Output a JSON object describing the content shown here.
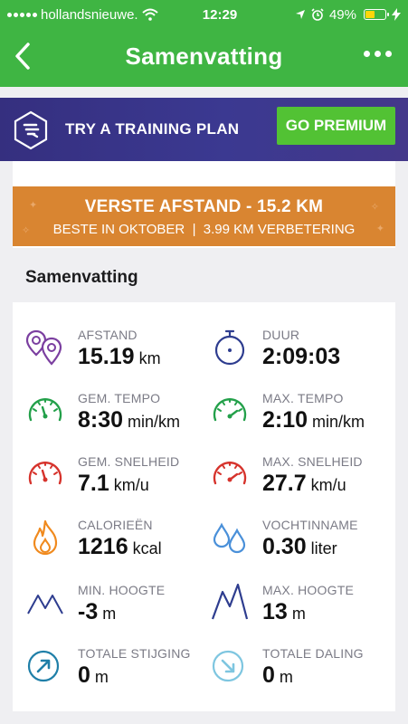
{
  "status_bar": {
    "carrier": "hollandsnieuwe.",
    "time": "12:29",
    "battery": "49%",
    "battery_level": 0.49
  },
  "nav": {
    "title": "Samenvatting"
  },
  "promo": {
    "text": "TRY A TRAINING PLAN",
    "button": "GO PREMIUM"
  },
  "record": {
    "title": "VERSTE AFSTAND - 15.2 KM",
    "subtitle": "BESTE IN OKTOBER  |  3.99 KM VERBETERING"
  },
  "summary": {
    "heading": "Samenvatting",
    "stats": [
      {
        "label": "AFSTAND",
        "value": "15.19",
        "unit": "km",
        "icon": "location-pins-icon"
      },
      {
        "label": "DUUR",
        "value": "2:09:03",
        "unit": "",
        "icon": "stopwatch-icon"
      },
      {
        "label": "GEM. TEMPO",
        "value": "8:30",
        "unit": "min/km",
        "icon": "speedometer-icon"
      },
      {
        "label": "MAX. TEMPO",
        "value": "2:10",
        "unit": "min/km",
        "icon": "speedometer-icon"
      },
      {
        "label": "GEM. SNELHEID",
        "value": "7.1",
        "unit": "km/u",
        "icon": "speedometer-icon"
      },
      {
        "label": "MAX. SNELHEID",
        "value": "27.7",
        "unit": "km/u",
        "icon": "speedometer-icon"
      },
      {
        "label": "CALORIEËN",
        "value": "1216",
        "unit": "kcal",
        "icon": "flame-icon"
      },
      {
        "label": "VOCHTINNAME",
        "value": "0.30",
        "unit": "liter",
        "icon": "water-drops-icon"
      },
      {
        "label": "MIN. HOOGTE",
        "value": "-3",
        "unit": "m",
        "icon": "mountain-icon"
      },
      {
        "label": "MAX. HOOGTE",
        "value": "13",
        "unit": "m",
        "icon": "mountain-icon"
      },
      {
        "label": "TOTALE STIJGING",
        "value": "0",
        "unit": "m",
        "icon": "ascent-arrow-icon"
      },
      {
        "label": "TOTALE DALING",
        "value": "0",
        "unit": "m",
        "icon": "descent-arrow-icon"
      }
    ]
  },
  "colors": {
    "header_green": "#3fb543",
    "premium_green": "#52c234",
    "promo_purple": "#3b3991",
    "record_orange": "#d98531",
    "distance_purple": "#7b3fa0",
    "tempo_green": "#23a04a",
    "speed_red": "#d6332c",
    "calorie_orange": "#f08a1e",
    "water_blue": "#4a90d9",
    "mountain_navy": "#2e3d8f",
    "ascent_teal": "#1f7fa8",
    "descent_lightblue": "#7ec6e0"
  }
}
